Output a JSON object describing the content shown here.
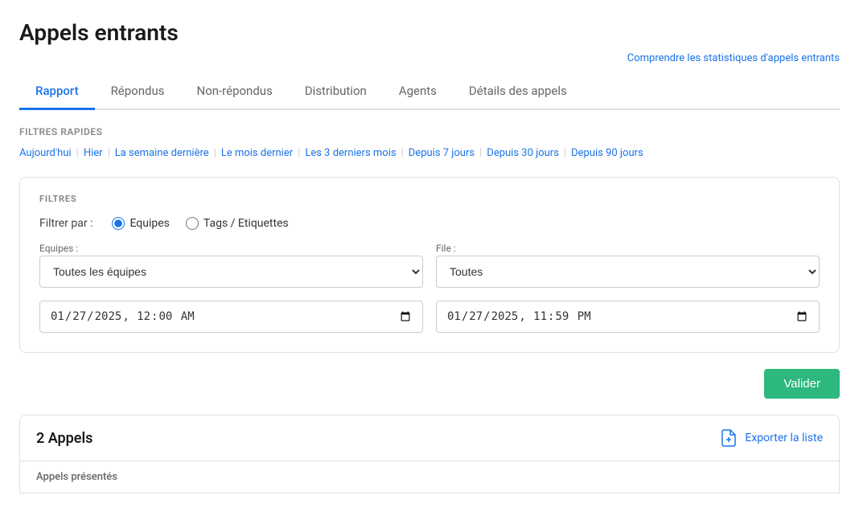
{
  "page": {
    "title": "Appels entrants",
    "help_link_text": "Comprendre les statistiques d'appels entrants"
  },
  "tabs": [
    {
      "id": "rapport",
      "label": "Rapport",
      "active": true
    },
    {
      "id": "repondus",
      "label": "Répondus",
      "active": false
    },
    {
      "id": "non-repondus",
      "label": "Non-répondus",
      "active": false
    },
    {
      "id": "distribution",
      "label": "Distribution",
      "active": false
    },
    {
      "id": "agents",
      "label": "Agents",
      "active": false
    },
    {
      "id": "details",
      "label": "Détails des appels",
      "active": false
    }
  ],
  "quick_filters": {
    "label": "FILTRES RAPIDES",
    "items": [
      {
        "id": "today",
        "label": "Aujourd'hui"
      },
      {
        "id": "yesterday",
        "label": "Hier"
      },
      {
        "id": "last-week",
        "label": "La semaine dernière"
      },
      {
        "id": "last-month",
        "label": "Le mois dernier"
      },
      {
        "id": "last-3-months",
        "label": "Les 3 derniers mois"
      },
      {
        "id": "last-7-days",
        "label": "Depuis 7 jours"
      },
      {
        "id": "last-30-days",
        "label": "Depuis 30 jours"
      },
      {
        "id": "last-90-days",
        "label": "Depuis 90 jours"
      }
    ]
  },
  "filters": {
    "section_title": "FILTRES",
    "filter_by_label": "Filtrer par :",
    "filter_options": [
      {
        "id": "equipes",
        "label": "Equipes",
        "selected": true
      },
      {
        "id": "tags",
        "label": "Tags / Etiquettes",
        "selected": false
      }
    ],
    "equipes_select": {
      "label": "Equipes :",
      "selected": "Toutes les équipes",
      "options": [
        "Toutes les équipes"
      ]
    },
    "file_select": {
      "label": "File :",
      "selected": "Toutes",
      "options": [
        "Toutes"
      ]
    },
    "date_start": {
      "value": "2025-01-27T00:00",
      "display": "27/01/2025  00:00"
    },
    "date_end": {
      "value": "2025-01-27T23:59",
      "display": "27/01/2025  23:59"
    },
    "validate_button": "Valider"
  },
  "results": {
    "count_label": "2 Appels",
    "export_label": "Exporter la liste"
  },
  "table": {
    "column_partial": "Appels présentés"
  }
}
